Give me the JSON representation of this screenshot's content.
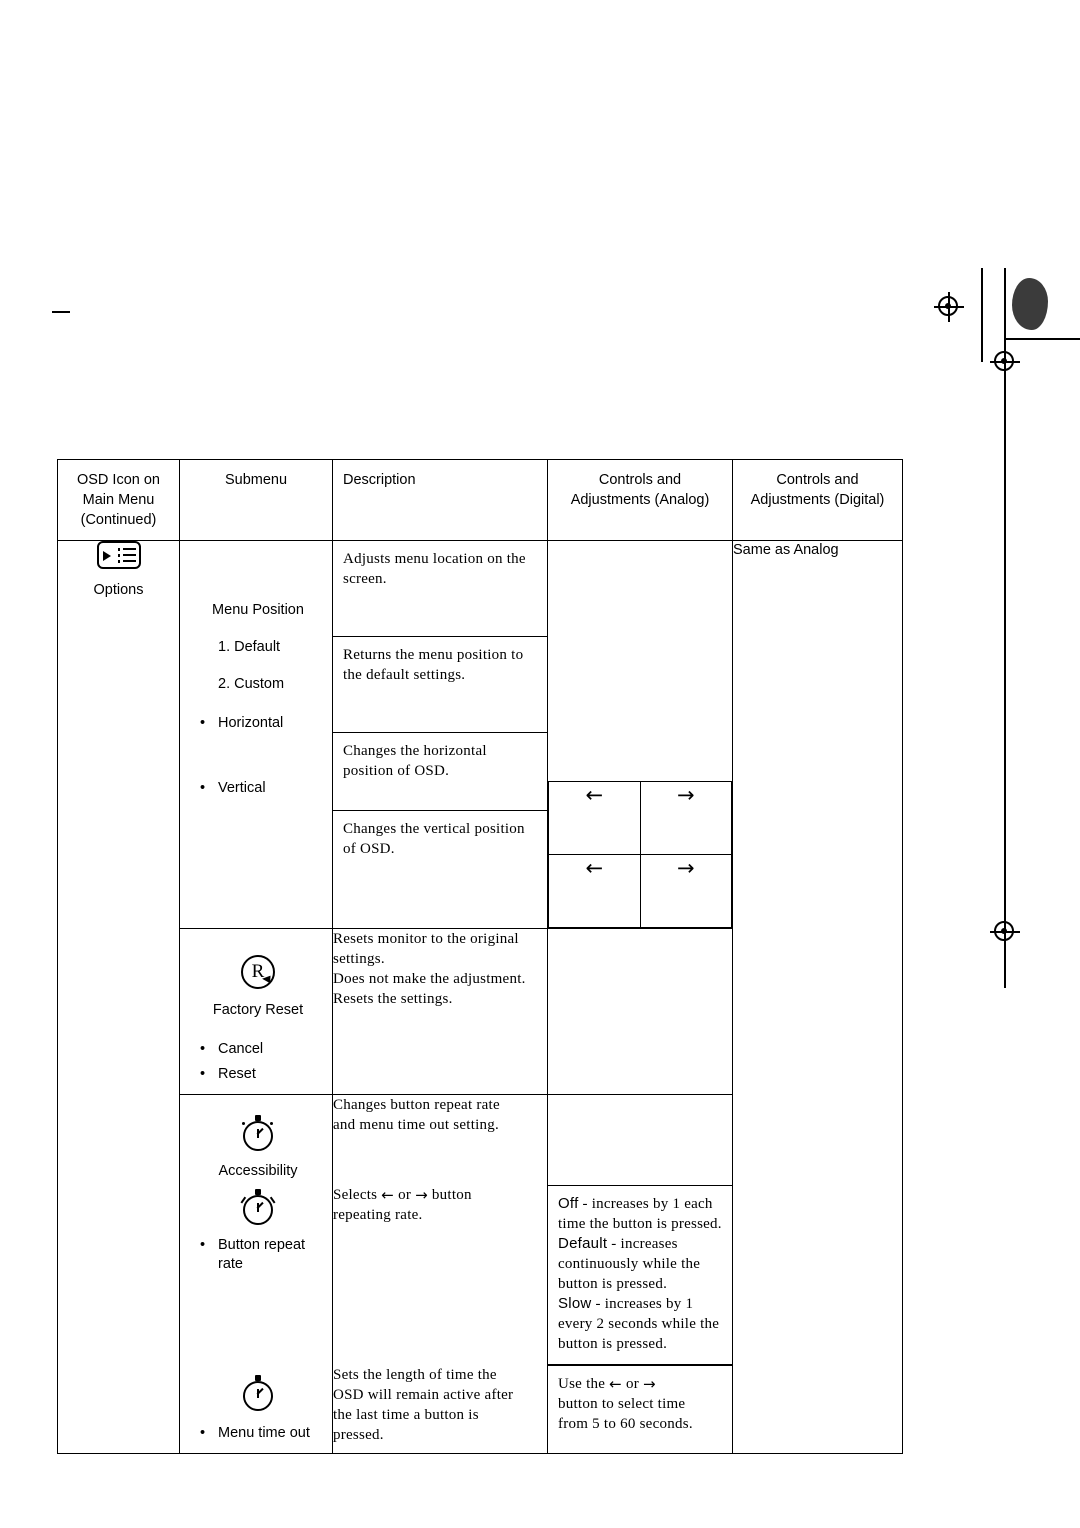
{
  "page": {
    "title": "OSD Options Reference Table"
  },
  "table": {
    "headers": {
      "col1_line1": "OSD Icon on",
      "col1_line2": "Main Menu",
      "col1_line3": "(Continued)",
      "col2": "Submenu",
      "col3": "Description",
      "col4_line1": "Controls and",
      "col4_line2": "Adjustments (Analog)",
      "col5_line1": "Controls and",
      "col5_line2": "Adjustments (Digital)"
    },
    "rows": {
      "options": {
        "icon_name": "options-icon",
        "icon_label": "Options",
        "submenu_title": "Menu Position",
        "submenu_items": [
          "1. Default",
          "2. Custom"
        ],
        "bullets": [
          "Horizontal",
          "Vertical"
        ],
        "desc_menu_position": "Adjusts menu location on the screen.",
        "desc_default": "Returns the menu position to the default settings.",
        "desc_horizontal_l1": "Changes the horizontal",
        "desc_horizontal_l2": "position of OSD.",
        "desc_vertical_l1": "Changes the vertical position",
        "desc_vertical_l2": "of OSD.",
        "arrow_left": "←",
        "arrow_right": "→",
        "digital": "Same as Analog"
      },
      "factory_reset": {
        "icon_name": "factory-reset-icon",
        "icon_label": "Factory Reset",
        "bullets": [
          "Cancel",
          "Reset"
        ],
        "desc_l1": "Resets monitor to the original settings.",
        "desc_l2": "Does not make the adjustment.",
        "desc_l3": "Resets the settings."
      },
      "accessibility": {
        "icon_name": "accessibility-icon",
        "icon_label": "Accessibility",
        "desc_l1": "Changes button repeat rate",
        "desc_l2": "and menu time out setting."
      },
      "button_repeat_rate": {
        "icon_name": "button-repeat-rate-icon",
        "label_l1": "Button repeat",
        "label_l2": "rate",
        "desc_pre": "Selects",
        "desc_arrow_left": "←",
        "desc_or": "or",
        "desc_arrow_right": "→",
        "desc_post": "button",
        "desc_l2": "repeating rate.",
        "adj_off_label": "Off",
        "adj_off_text": "- increases by 1 each time the button is pressed.",
        "adj_default_label": "Default",
        "adj_default_text": "- increases continuously while the button is pressed.",
        "adj_slow_label": "Slow",
        "adj_slow_text": "- increases by 1 every 2 seconds while the button is pressed."
      },
      "menu_time_out": {
        "icon_name": "menu-time-out-icon",
        "label": "Menu time out",
        "desc_l1": "Sets the length of time the",
        "desc_l2": "OSD will remain active after",
        "desc_l3": "the last time a button is",
        "desc_l4": "pressed.",
        "adj_pre": "Use the",
        "adj_arrow_left": "←",
        "adj_or": "or",
        "adj_arrow_right": "→",
        "adj_l2": "button to select time",
        "adj_l3": "from 5 to 60 seconds."
      }
    }
  }
}
